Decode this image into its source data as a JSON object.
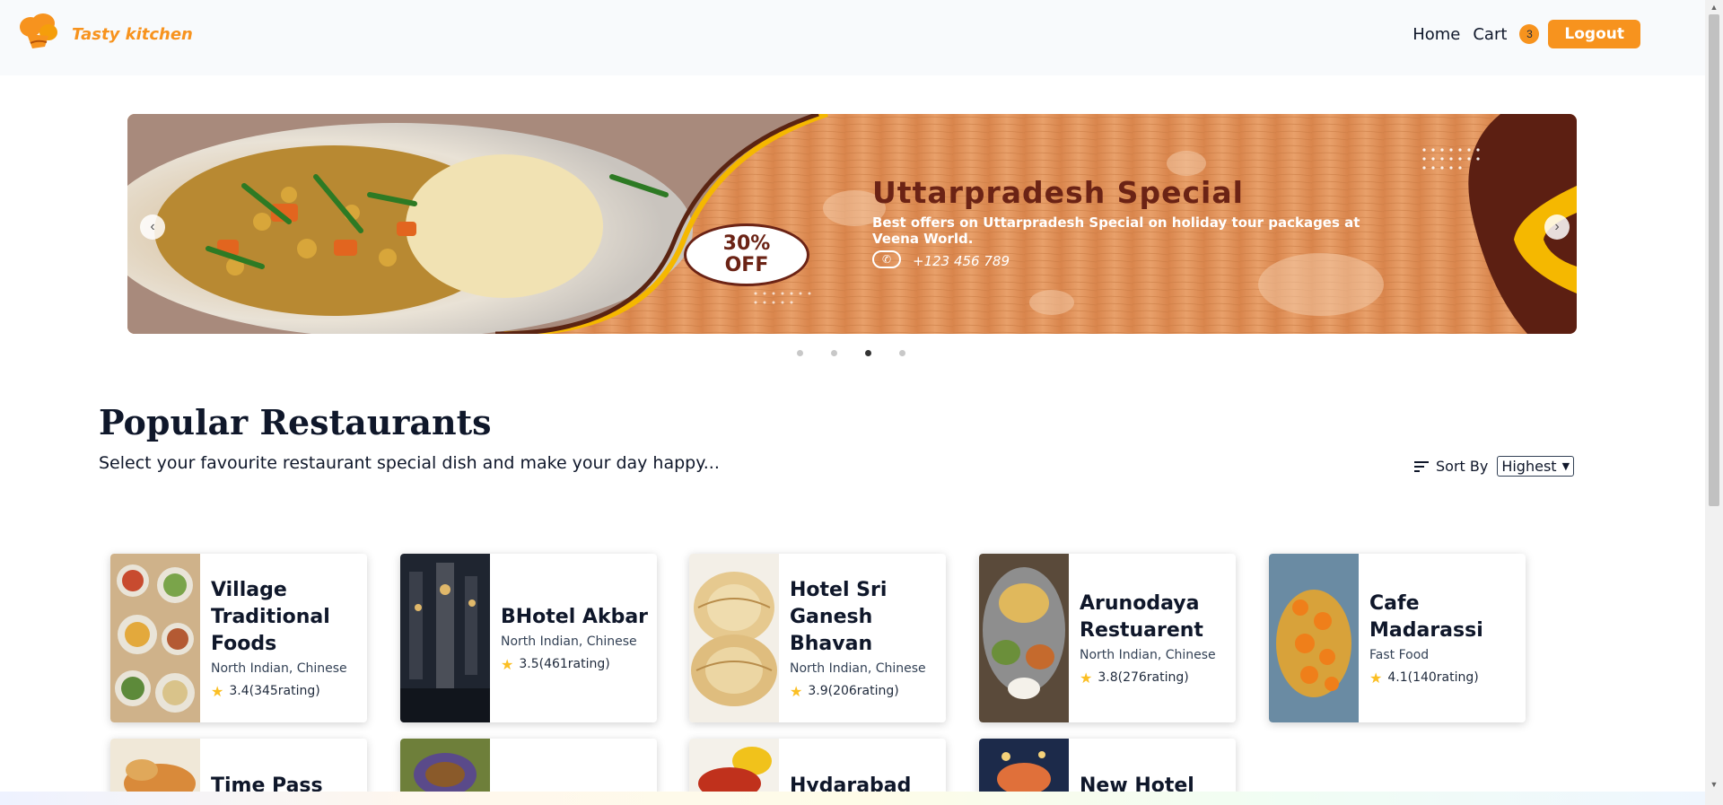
{
  "navbar": {
    "brand": "Tasty kitchen",
    "links": [
      "Home",
      "Cart"
    ],
    "cart_count": "3",
    "logout_label": "Logout"
  },
  "carousel": {
    "title": "Uttarpradesh Special",
    "description": "Best offers on Uttarpradesh Special on holiday tour packages at Veena World.",
    "phone": "+123 456 789",
    "discount_line1": "30%",
    "discount_line2": "OFF",
    "slide_count": 4,
    "active_slide": 3
  },
  "popular": {
    "title": "Popular Restaurants",
    "subtitle": "Select your favourite restaurant special dish and make your day happy...",
    "sort_label": "Sort By",
    "sort_value": "Highest"
  },
  "restaurants": [
    {
      "name": "Village Traditional Foods",
      "cuisine": "North Indian, Chinese",
      "rating": "3.4(345rating)"
    },
    {
      "name": "BHotel Akbar",
      "cuisine": "North Indian, Chinese",
      "rating": "3.5(461rating)"
    },
    {
      "name": "Hotel Sri Ganesh Bhavan",
      "cuisine": "North Indian, Chinese",
      "rating": "3.9(206rating)"
    },
    {
      "name": "Arunodaya Restuarent",
      "cuisine": "North Indian, Chinese",
      "rating": "3.8(276rating)"
    },
    {
      "name": "Cafe Madarassi",
      "cuisine": "Fast Food",
      "rating": "4.1(140rating)"
    },
    {
      "name": "Time Pass The",
      "cuisine": "",
      "rating": ""
    },
    {
      "name": "",
      "cuisine": "",
      "rating": ""
    },
    {
      "name": "Hydarabad",
      "cuisine": "",
      "rating": ""
    },
    {
      "name": "New Hotel",
      "cuisine": "",
      "rating": ""
    }
  ],
  "colors": {
    "accent": "#f7931e",
    "banner_wood": "#e0915a",
    "banner_dark": "#6b2315",
    "star": "#fbbf24"
  }
}
